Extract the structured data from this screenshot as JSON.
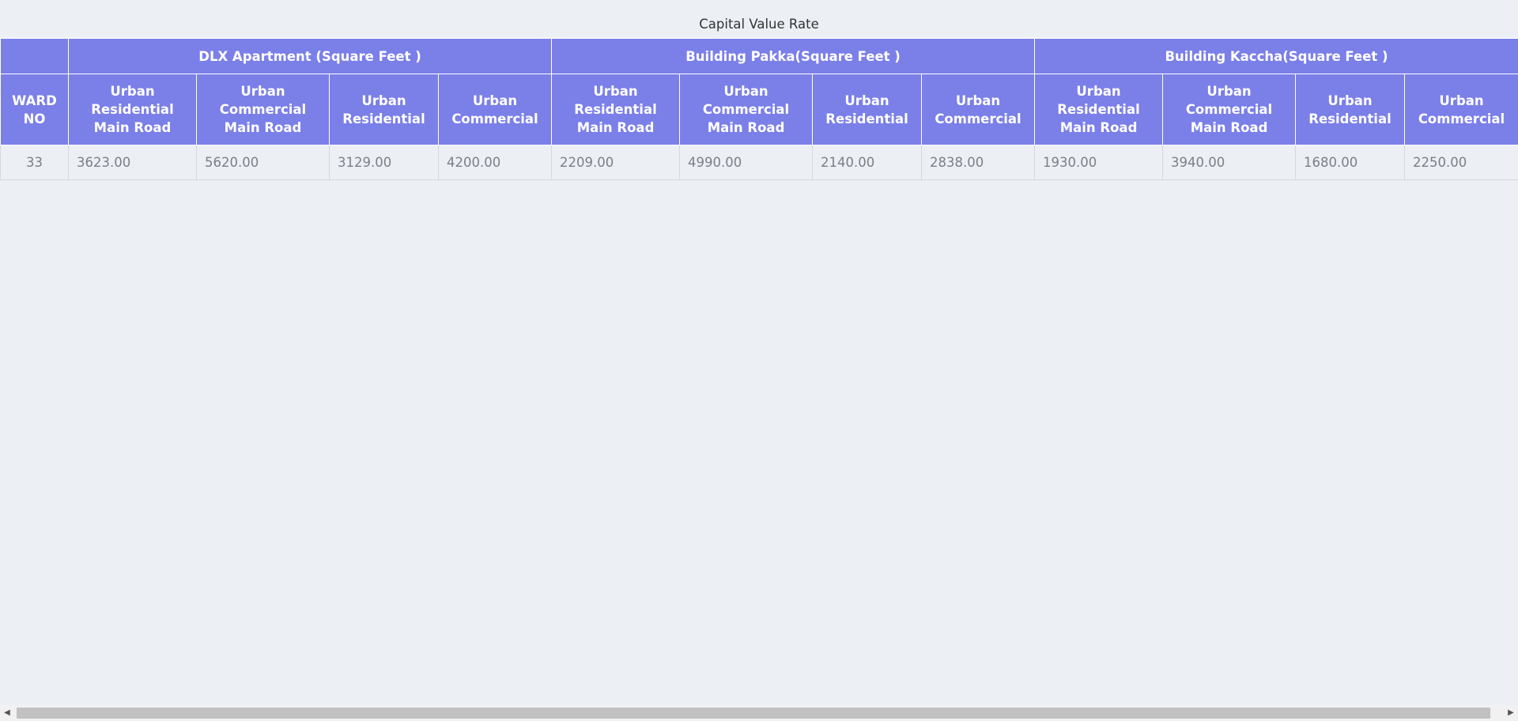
{
  "caption": "Capital Value Rate",
  "table": {
    "ward_header": "WARD NO",
    "groups": [
      "DLX Apartment (Square Feet )",
      "Building Pakka(Square Feet )",
      "Building Kaccha(Square Feet )"
    ],
    "sub_headers": [
      "Urban Residential Main Road",
      "Urban Commercial Main Road",
      "Urban Residential",
      "Urban Commercial",
      "Urban Residential Main Road",
      "Urban Commercial Main Road",
      "Urban Residential",
      "Urban Commercial",
      "Urban Residential Main Road",
      "Urban Commercial Main Road",
      "Urban Residential",
      "Urban Commercial"
    ],
    "rows": [
      {
        "ward": "33",
        "values": [
          "3623.00",
          "5620.00",
          "3129.00",
          "4200.00",
          "2209.00",
          "4990.00",
          "2140.00",
          "2838.00",
          "1930.00",
          "3940.00",
          "1680.00",
          "2250.00"
        ]
      }
    ]
  },
  "scrollbar": {
    "left_icon": "triangle-left-icon",
    "right_icon": "triangle-right-icon"
  }
}
